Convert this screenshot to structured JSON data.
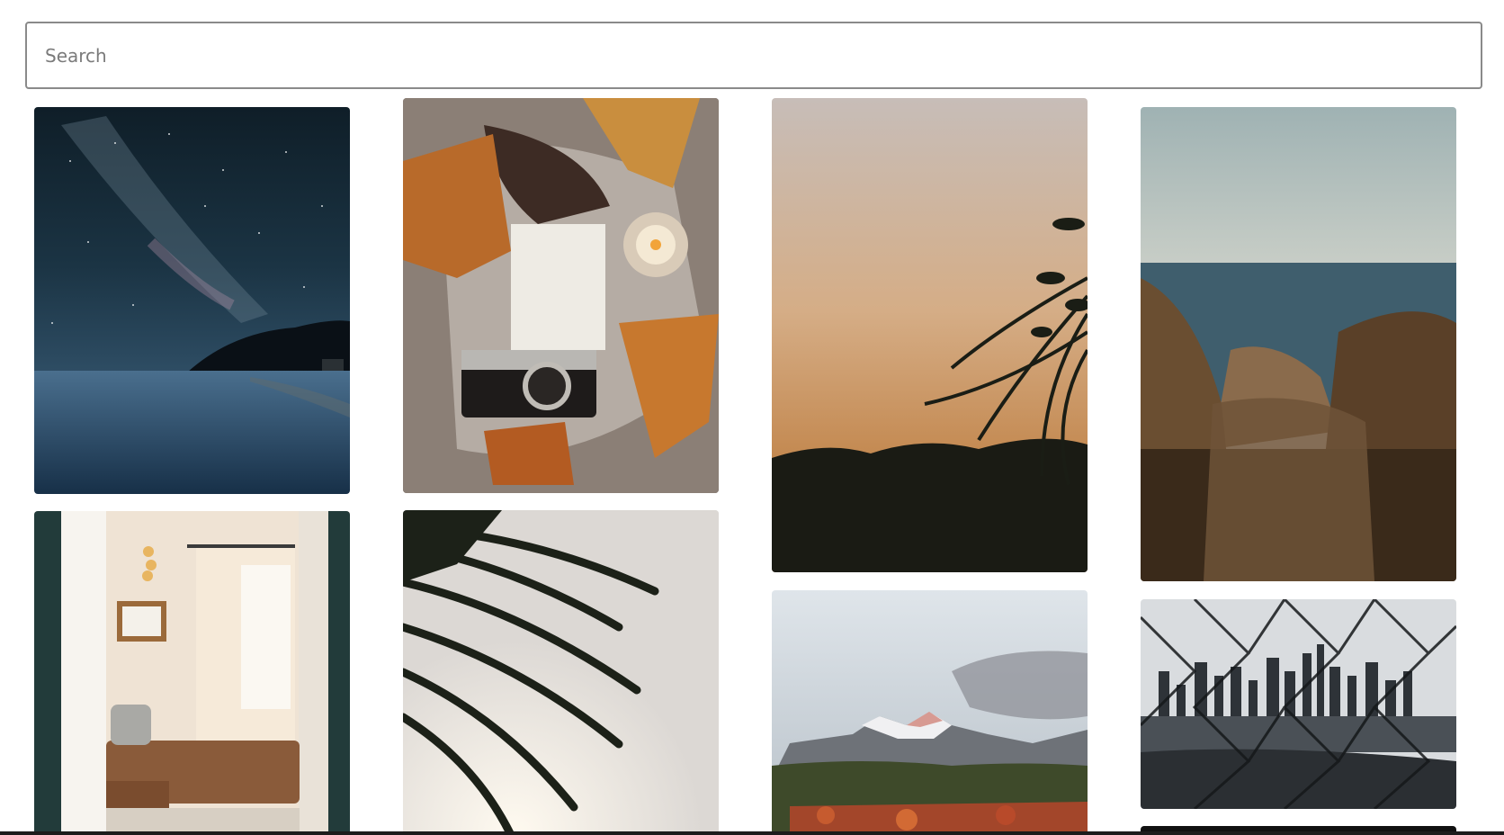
{
  "search": {
    "placeholder": "Search",
    "value": ""
  },
  "gallery": {
    "photos": [
      {
        "subject": "milky-way-over-lake"
      },
      {
        "subject": "autumn-camera-flatlay"
      },
      {
        "subject": "palm-silhouette-sunset"
      },
      {
        "subject": "sea-cliff-through-grass"
      },
      {
        "subject": "living-room-interior"
      },
      {
        "subject": "palm-fronds-backlit"
      },
      {
        "subject": "snowy-mountains-autumn-forest"
      },
      {
        "subject": "city-skyline-through-fence"
      },
      {
        "subject": "dark-photo"
      }
    ]
  }
}
